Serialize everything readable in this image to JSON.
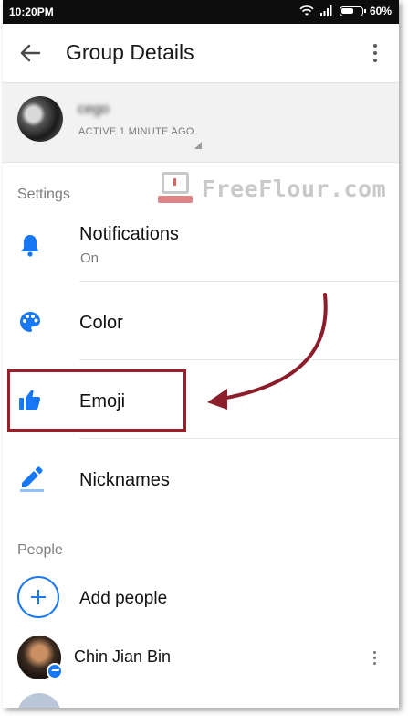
{
  "status_bar": {
    "time": "10:20PM",
    "battery": "60%"
  },
  "app_bar": {
    "title": "Group Details"
  },
  "profile": {
    "name": "cego",
    "status": "ACTIVE 1 MINUTE AGO"
  },
  "watermark": {
    "text": "FreeFlour.com"
  },
  "settings": {
    "section_label": "Settings",
    "items": [
      {
        "label": "Notifications",
        "sub": "On",
        "icon": "bell-icon"
      },
      {
        "label": "Color",
        "icon": "palette-icon"
      },
      {
        "label": "Emoji",
        "icon": "thumbs-up-icon"
      },
      {
        "label": "Nicknames",
        "icon": "pencil-icon"
      }
    ]
  },
  "people": {
    "section_label": "People",
    "add_label": "Add people",
    "members": [
      {
        "name": "Chin Jian Bin"
      }
    ]
  },
  "colors": {
    "accent": "#1877f2",
    "highlight": "#9a1f29",
    "arrow": "#8b1e2a"
  }
}
